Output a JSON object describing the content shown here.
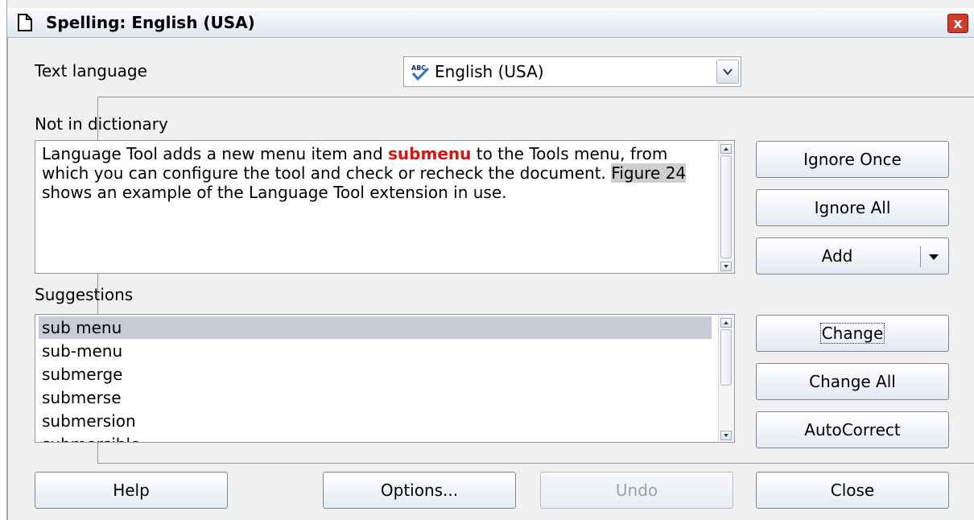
{
  "window": {
    "title": "Spelling: English (USA)",
    "close_glyph": "x"
  },
  "text_language": {
    "label": "Text language",
    "value": "English (USA)"
  },
  "not_in_dictionary": {
    "label": "Not in dictionary",
    "segments": [
      {
        "text": "Language Tool adds a new menu item and ",
        "style": "normal"
      },
      {
        "text": "submenu",
        "style": "error"
      },
      {
        "text": " to the Tools menu, from which you can configure the tool and check or recheck the document. ",
        "style": "normal"
      },
      {
        "text": "Figure 24",
        "style": "grey"
      },
      {
        "text": " shows an example of the Language Tool extension in use.",
        "style": "normal"
      }
    ]
  },
  "suggestions": {
    "label": "Suggestions",
    "items": [
      "sub menu",
      "sub-menu",
      "submerge",
      "submerse",
      "submersion",
      "submersible"
    ],
    "selected_index": 0
  },
  "buttons": {
    "ignore_once": "Ignore Once",
    "ignore_all": "Ignore All",
    "add": "Add",
    "change": "Change",
    "change_all": "Change All",
    "autocorrect": "AutoCorrect",
    "help": "Help",
    "options": "Options...",
    "undo": "Undo",
    "close": "Close"
  },
  "colors": {
    "error_text": "#e01010",
    "selection": "#c8ccd6",
    "close_button": "#d23a2a"
  }
}
